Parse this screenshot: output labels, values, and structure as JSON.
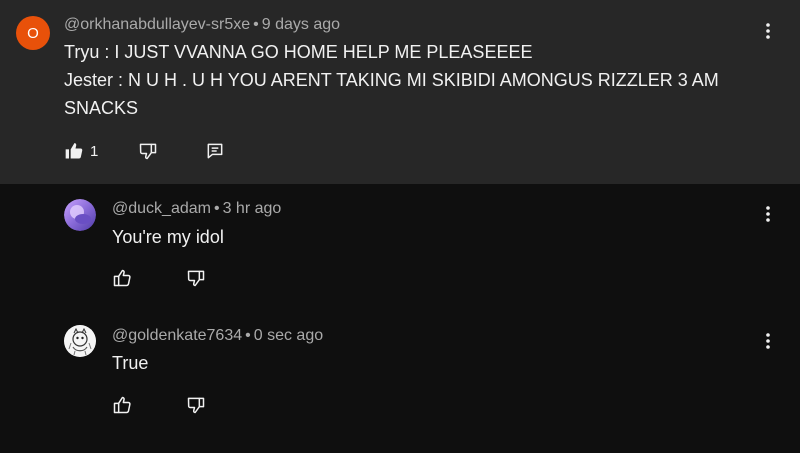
{
  "parent": {
    "avatar_letter": "O",
    "author": "@orkhanabdullayev-sr5xe",
    "separator": "•",
    "time": "9 days ago",
    "lines": [
      "Tryu : I JUST VVANNA GO HOME HELP ME PLEASEEEE",
      "Jester : N U H . U H YOU ARENT TAKING MI SKIBIDI AMONGUS RIZZLER 3 AM",
      "SNACKS"
    ],
    "like_count": "1"
  },
  "replies": [
    {
      "author": "@duck_adam",
      "separator": "•",
      "time": "3 hr ago",
      "text": "You're my idol"
    },
    {
      "author": "@goldenkate7634",
      "separator": "•",
      "time": "0 sec ago",
      "text": "True"
    }
  ],
  "colors": {
    "background": "#0f0f0f",
    "highlight_background": "#272727",
    "avatar_orange": "#e8510a",
    "meta_text": "#aaaaaa",
    "primary_text": "#f1f1f1"
  },
  "icons": [
    "like-filled-icon",
    "like-outline-icon",
    "dislike-icon",
    "reply-icon",
    "more-vertical-icon"
  ]
}
